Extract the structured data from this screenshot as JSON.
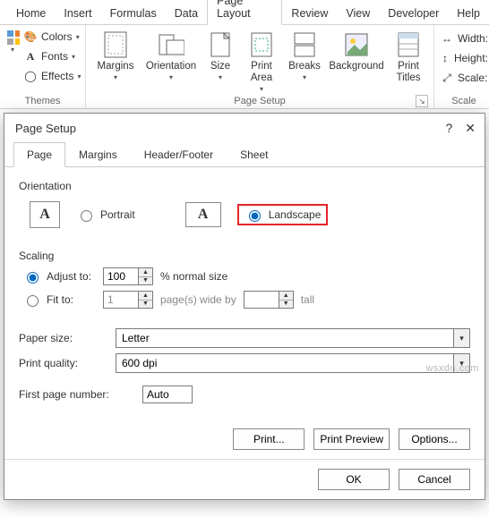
{
  "ribbon": {
    "tabs": [
      "Home",
      "Insert",
      "Formulas",
      "Data",
      "Page Layout",
      "Review",
      "View",
      "Developer",
      "Help"
    ],
    "active": "Page Layout",
    "themes": {
      "colors": "Colors",
      "fonts": "Fonts",
      "effects": "Effects",
      "label": "Themes"
    },
    "pagesetup": {
      "margins": "Margins",
      "orientation": "Orientation",
      "size": "Size",
      "printarea": "Print\nArea",
      "breaks": "Breaks",
      "background": "Background",
      "printtitles": "Print\nTitles",
      "label": "Page Setup"
    },
    "scale": {
      "width": "Width:",
      "height": "Height:",
      "scale": "Scale:",
      "label": "Scale"
    }
  },
  "dialog": {
    "title": "Page Setup",
    "tabs": [
      "Page",
      "Margins",
      "Header/Footer",
      "Sheet"
    ],
    "active": "Page",
    "orientation": {
      "label": "Orientation",
      "portrait": "Portrait",
      "landscape": "Landscape",
      "selected": "landscape"
    },
    "scaling": {
      "label": "Scaling",
      "adjust": "Adjust to:",
      "adjust_val": "100",
      "adjust_suffix": "% normal size",
      "fit": "Fit to:",
      "fit_w": "1",
      "fit_mid": "page(s) wide by",
      "fit_h": "",
      "fit_suffix": "tall"
    },
    "paper": {
      "label": "Paper size:",
      "value": "Letter"
    },
    "quality": {
      "label": "Print quality:",
      "value": "600 dpi"
    },
    "firstpage": {
      "label": "First page number:",
      "value": "Auto"
    },
    "buttons": {
      "print": "Print...",
      "preview": "Print Preview",
      "options": "Options...",
      "ok": "OK",
      "cancel": "Cancel"
    }
  },
  "watermark": "wsxdn.com"
}
